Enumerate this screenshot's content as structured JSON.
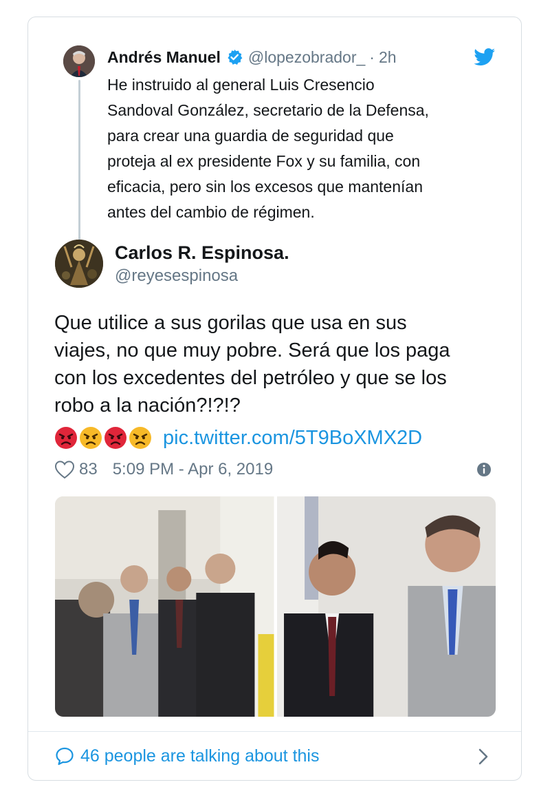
{
  "parent_tweet": {
    "name": "Andrés Manuel",
    "handle": "@lopezobrador_",
    "separator": "·",
    "time": "2h",
    "text": "He instruido al general Luis Cresencio\nSandoval González, secretario de la Defensa,\npara crear una guardia de seguridad que\nproteja al ex presidente Fox y su familia, con\neficacia, pero sin los excesos que mantenían\nantes del cambio de régimen."
  },
  "tweet": {
    "author_name": "Carlos R. Espinosa.",
    "author_handle": "@reyesespinosa",
    "text": "Que utilice a sus gorilas que usa en sus\nviajes, no que muy pobre. Será que los paga\ncon los excedentes del petróleo y que se los\nrobo a la nación?!?!?",
    "emojis": [
      "angry-face-red",
      "angry-face-yellow",
      "angry-face-red",
      "angry-face-yellow"
    ],
    "link": "pic.twitter.com/5T9BoXMX2D",
    "likes": "83",
    "timestamp": "5:09 PM - Apr 6, 2019"
  },
  "footer": {
    "talking": "46 people are talking about this"
  },
  "icons": {
    "verified": "verified-badge-icon",
    "brand": "twitter-bird-icon",
    "like": "heart-icon",
    "info": "info-icon",
    "conversation": "speech-bubble-icon",
    "open": "chevron-right-icon"
  },
  "colors": {
    "link": "#1b95e0",
    "secondary_text": "#657786",
    "border": "#d7dde2",
    "thread_line": "#c4cfd6"
  }
}
